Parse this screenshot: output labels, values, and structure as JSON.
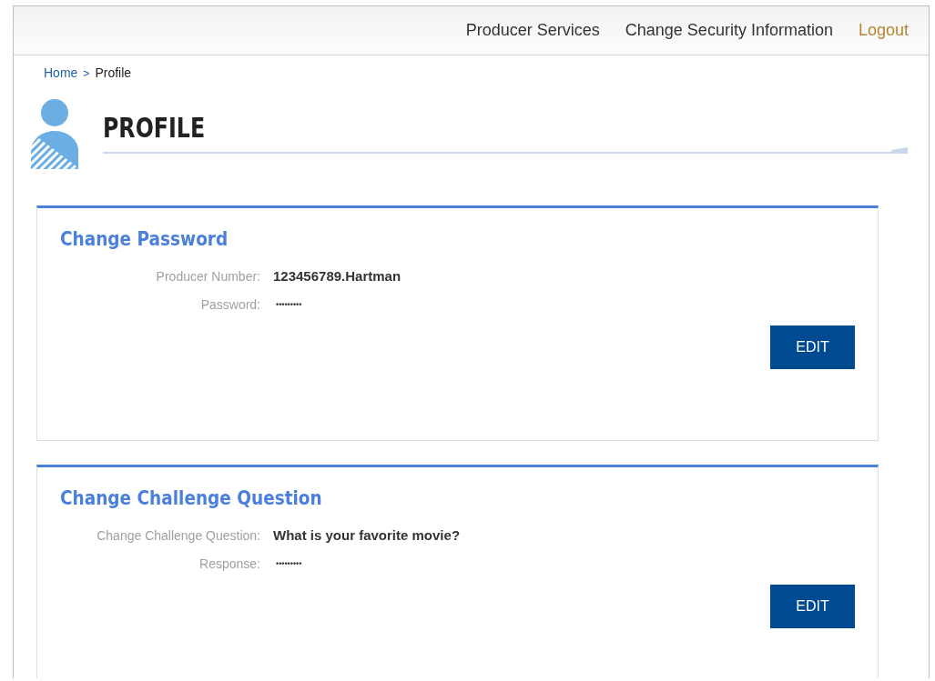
{
  "header": {
    "nav": [
      "Producer Services",
      "Change Security Information"
    ],
    "logout": "Logout"
  },
  "breadcrumb": {
    "home": "Home",
    "separator": ">",
    "current": "Profile"
  },
  "page_title": "PROFILE",
  "sections": [
    {
      "title": "Change Password",
      "fields": [
        {
          "label": "Producer Number:",
          "value": "123456789.Hartman",
          "kind": "text"
        },
        {
          "label": "Password:",
          "value": "•••••••••",
          "kind": "masked"
        }
      ],
      "button": "EDIT"
    },
    {
      "title": "Change Challenge Question",
      "fields": [
        {
          "label": "Change Challenge Question:",
          "value": "What is your favorite movie?",
          "kind": "text"
        },
        {
          "label": "Response:",
          "value": "•••••••••",
          "kind": "masked"
        }
      ],
      "button": "EDIT"
    }
  ]
}
